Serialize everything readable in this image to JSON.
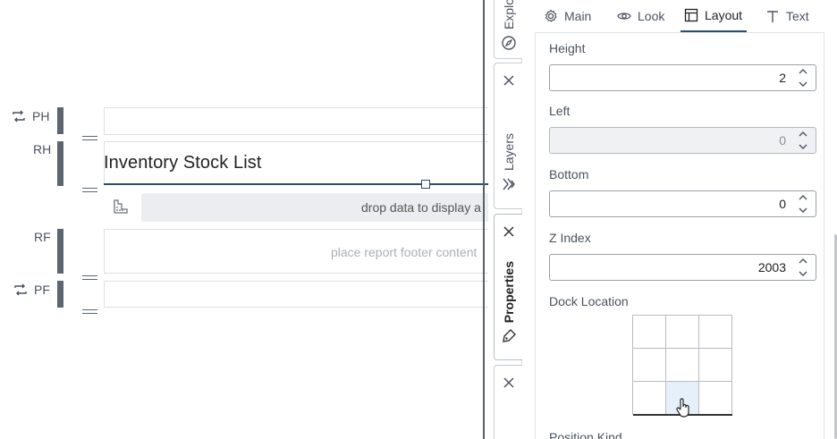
{
  "report": {
    "bands": {
      "ph": "PH",
      "rh": "RH",
      "rf": "RF",
      "pf": "PF"
    },
    "title": "Inventory Stock List",
    "drop_placeholder": "drop data to display a",
    "footer_placeholder": "place report footer content"
  },
  "side_tabs": {
    "explorer": "Explo",
    "layers": "Layers",
    "properties": "Properties"
  },
  "panel": {
    "tabs": [
      {
        "label": "Main",
        "icon": "gear-icon"
      },
      {
        "label": "Look",
        "icon": "eye-icon"
      },
      {
        "label": "Layout",
        "icon": "layout-icon"
      },
      {
        "label": "Text",
        "icon": "text-icon"
      }
    ],
    "active_tab": "Layout",
    "fields": {
      "height": {
        "label": "Height",
        "value": "2"
      },
      "left": {
        "label": "Left",
        "value": "0",
        "disabled": true
      },
      "bottom": {
        "label": "Bottom",
        "value": "0"
      },
      "z_index": {
        "label": "Z Index",
        "value": "2003"
      }
    },
    "dock_location": {
      "label": "Dock Location",
      "selected": "bottom-center"
    },
    "position_kind": {
      "label": "Position Kind"
    }
  },
  "colors": {
    "accent": "#2a4e6e",
    "band_bar": "#5c6670",
    "dock_selected": "#e6f0fa"
  }
}
